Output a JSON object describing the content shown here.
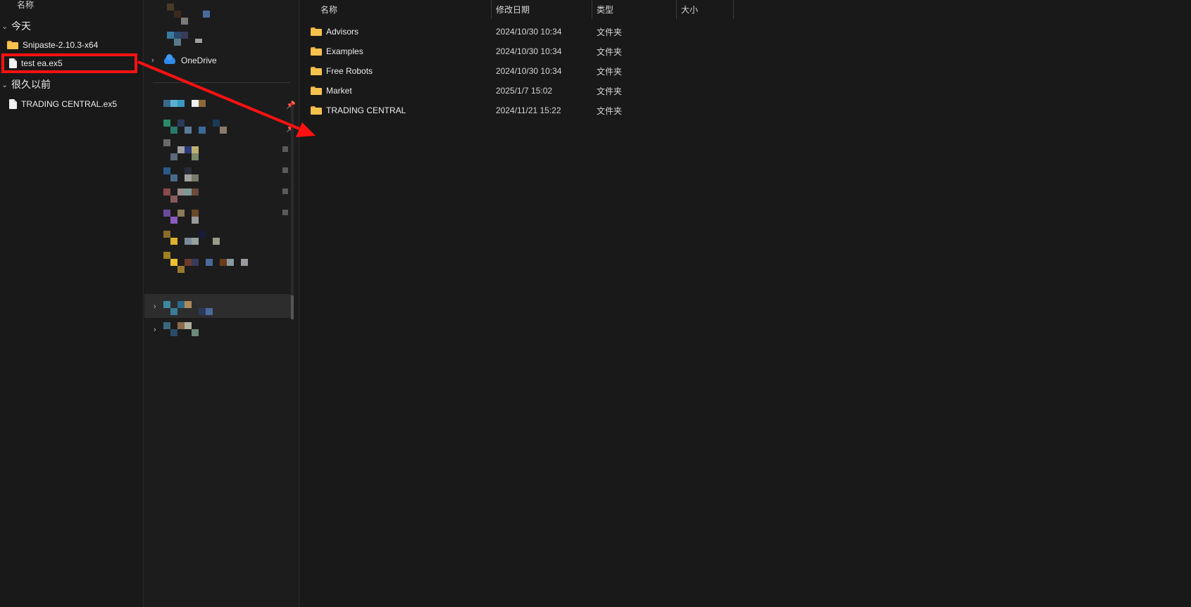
{
  "left_pane": {
    "header": "名称",
    "groups": [
      {
        "title": "今天",
        "items": [
          {
            "name": "Snipaste-2.10.3-x64",
            "kind": "folder"
          },
          {
            "name": "test ea.ex5",
            "kind": "file"
          }
        ]
      },
      {
        "title": "很久以前",
        "items": [
          {
            "name": "TRADING CENTRAL.ex5",
            "kind": "file"
          }
        ]
      }
    ]
  },
  "nav_pane": {
    "onedrive_label": "OneDrive"
  },
  "main_pane": {
    "columns": [
      "名称",
      "修改日期",
      "类型",
      "大小"
    ],
    "rows": [
      {
        "name": "Advisors",
        "date": "2024/10/30 10:34",
        "type": "文件夹"
      },
      {
        "name": "Examples",
        "date": "2024/10/30 10:34",
        "type": "文件夹"
      },
      {
        "name": "Free Robots",
        "date": "2024/10/30 10:34",
        "type": "文件夹"
      },
      {
        "name": "Market",
        "date": "2025/1/7 15:02",
        "type": "文件夹"
      },
      {
        "name": "TRADING CENTRAL",
        "date": "2024/11/21 15:22",
        "type": "文件夹"
      }
    ]
  },
  "colors": {
    "background": "#191919",
    "folder": "#f5c24d",
    "annotation": "#ff1111",
    "onedrive": "#2f8ae8"
  }
}
